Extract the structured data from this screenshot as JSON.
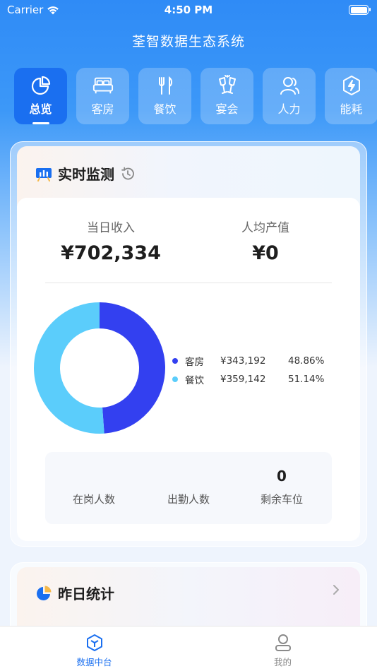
{
  "status_bar": {
    "carrier": "Carrier",
    "time": "4:50 PM"
  },
  "app": {
    "title": "荃智数据生态系统"
  },
  "nav_tabs": [
    {
      "label": "总览",
      "icon": "pie-chart-icon",
      "active": true
    },
    {
      "label": "客房",
      "icon": "bed-icon",
      "active": false
    },
    {
      "label": "餐饮",
      "icon": "fork-knife-icon",
      "active": false
    },
    {
      "label": "宴会",
      "icon": "wine-glasses-icon",
      "active": false
    },
    {
      "label": "人力",
      "icon": "people-icon",
      "active": false
    },
    {
      "label": "能耗",
      "icon": "energy-icon",
      "active": false
    }
  ],
  "realtime": {
    "title": "实时监测",
    "daily_revenue_label": "当日收入",
    "daily_revenue_value": "¥702,334",
    "per_capita_label": "人均产值",
    "per_capita_value": "¥0",
    "breakdown": [
      {
        "name": "客房",
        "amount": "¥343,192",
        "percent": "48.86%",
        "fraction": 0.4886,
        "color": "#3340f0"
      },
      {
        "name": "餐饮",
        "amount": "¥359,142",
        "percent": "51.14%",
        "fraction": 0.5114,
        "color": "#5bcdfb"
      }
    ],
    "staff": {
      "on_duty_label": "在岗人数",
      "on_duty_value": "",
      "attendance_label": "出勤人数",
      "attendance_value": "",
      "parking_label": "剩余车位",
      "parking_value": "0"
    }
  },
  "yesterday": {
    "title": "昨日统计"
  },
  "tabbar": [
    {
      "label": "数据中台",
      "icon": "cube-icon",
      "active": true
    },
    {
      "label": "我的",
      "icon": "user-icon",
      "active": false
    }
  ],
  "colors": {
    "primary": "#1a6ff0",
    "room": "#3340f0",
    "dining": "#5bcdfb"
  }
}
